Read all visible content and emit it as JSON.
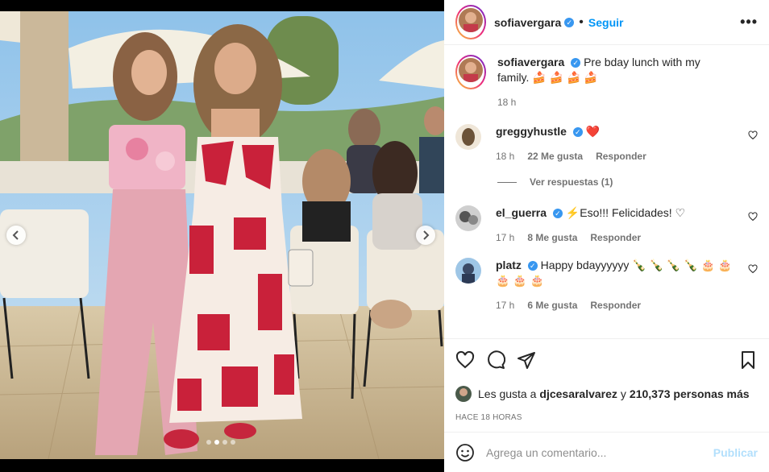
{
  "post": {
    "username": "sofiavergara",
    "follow_label": "Seguir",
    "more_label": "•••",
    "caption": "Pre bday lunch with my family.",
    "caption_emoji": "🍰 🍰 🍰 🍰",
    "caption_time": "18 h"
  },
  "carousel": {
    "slide_count": 4,
    "active_index": 1
  },
  "comments": [
    {
      "username": "greggyhustle",
      "text": "",
      "emoji": "❤️",
      "time": "18 h",
      "likes": "22 Me gusta",
      "reply": "Responder",
      "view_replies": "Ver respuestas (1)"
    },
    {
      "username": "el_guerra",
      "text": "Eso!!! Felicidades! ♡",
      "emoji": "⚡",
      "time": "17 h",
      "likes": "8 Me gusta",
      "reply": "Responder"
    },
    {
      "username": "platz",
      "text": "Happy bdayyyyyy",
      "emoji": "🍾 🍾 🍾 🍾 🎂 🎂",
      "emoji2": "🎂 🎂 🎂",
      "time": "17 h",
      "likes": "6 Me gusta",
      "reply": "Responder"
    }
  ],
  "likes": {
    "prefix": "Les gusta a",
    "user": "djcesaralvarez",
    "middle": "y",
    "count": "210,373 personas más"
  },
  "timestamp": "HACE 18 HORAS",
  "add_comment": {
    "placeholder": "Agrega un comentario...",
    "publish": "Publicar"
  },
  "colors": {
    "accent": "#0095f6",
    "verified": "#3897f0",
    "publish_disabled": "#b2dffc",
    "heart": "#ed4956"
  }
}
